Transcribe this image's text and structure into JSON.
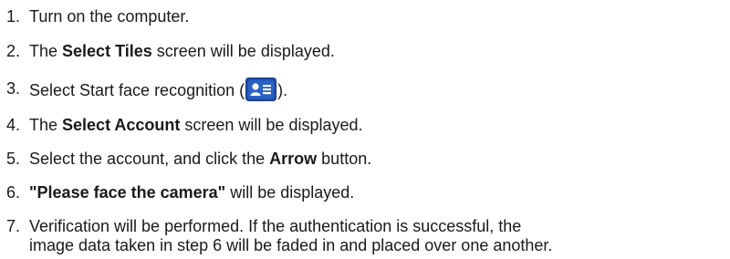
{
  "steps": [
    {
      "number": "1.",
      "text": "Turn on the computer."
    },
    {
      "number": "2.",
      "pre": "The ",
      "bold": "Select Tiles",
      "post": " screen will be displayed."
    },
    {
      "number": "3.",
      "pre": "Select Start face recognition (",
      "icon": "face-recognition-tile-icon",
      "post": ")."
    },
    {
      "number": "4.",
      "pre": "The ",
      "bold": "Select Account",
      "post": " screen will be displayed."
    },
    {
      "number": "5.",
      "pre": "Select the account, and click the ",
      "bold": "Arrow",
      "post": " button."
    },
    {
      "number": "6.",
      "bold": "\"Please face the camera\"",
      "post": " will be displayed."
    },
    {
      "number": "7.",
      "line1": "Verification will be performed. If the authentication is successful, the",
      "line2": "image data taken in step 6 will be faded in and placed over one another."
    }
  ],
  "colors": {
    "text": "#1a1a1a",
    "icon_bg": "#1f4fa8",
    "icon_fg": "#ffffff"
  }
}
